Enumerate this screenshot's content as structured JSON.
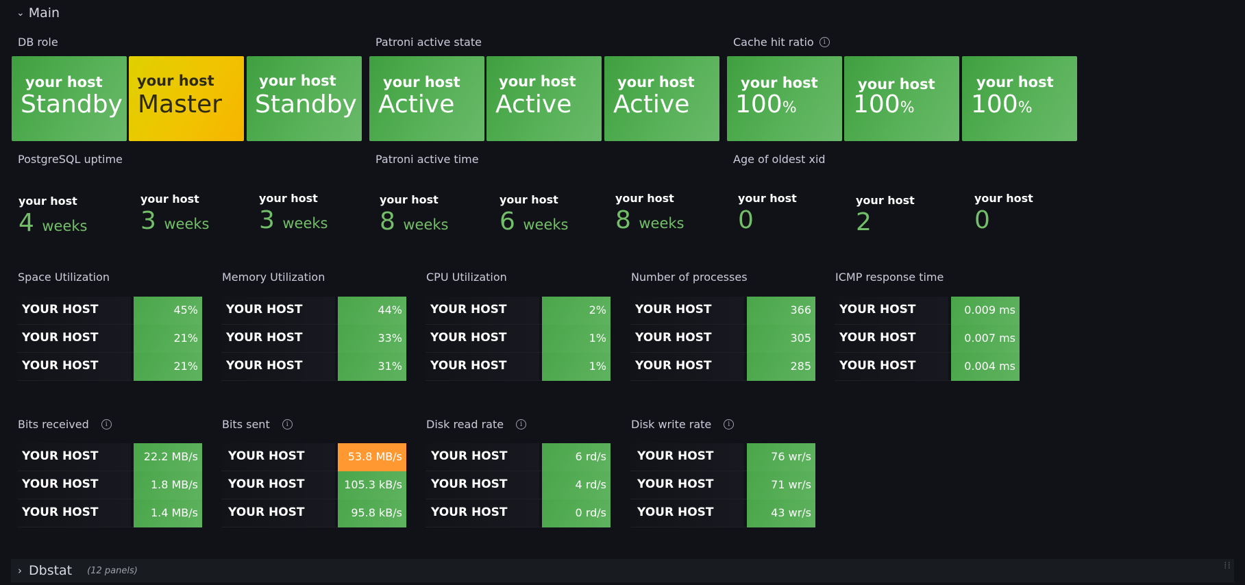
{
  "rows": {
    "main": {
      "label": "Main"
    },
    "dbstat": {
      "label": "Dbstat",
      "count": "(12 panels)"
    }
  },
  "db_role": {
    "title": "DB role",
    "items": [
      {
        "host": "your host",
        "value": "Standby",
        "color": "#56a64b"
      },
      {
        "host": "your host",
        "value": "Master",
        "color": "#f2cc0c"
      },
      {
        "host": "your host",
        "value": "Standby",
        "color": "#56a64b"
      }
    ]
  },
  "patroni_state": {
    "title": "Patroni active state",
    "items": [
      {
        "host": "your host",
        "value": "Active"
      },
      {
        "host": "your host",
        "value": "Active"
      },
      {
        "host": "your host",
        "value": "Active"
      }
    ]
  },
  "cache_hit": {
    "title": "Cache hit ratio",
    "items": [
      {
        "host": "your host",
        "value": "100",
        "unit": "%"
      },
      {
        "host": "your host",
        "value": "100",
        "unit": "%"
      },
      {
        "host": "your host",
        "value": "100",
        "unit": "%"
      }
    ]
  },
  "pg_uptime": {
    "title": "PostgreSQL uptime",
    "items": [
      {
        "host": "your host",
        "value": "4",
        "unit": "weeks"
      },
      {
        "host": "your host",
        "value": "3",
        "unit": "weeks"
      },
      {
        "host": "your host",
        "value": "3",
        "unit": "weeks"
      }
    ]
  },
  "patroni_time": {
    "title": "Patroni active time",
    "items": [
      {
        "host": "your host",
        "value": "8",
        "unit": "weeks"
      },
      {
        "host": "your host",
        "value": "6",
        "unit": "weeks"
      },
      {
        "host": "your host",
        "value": "8",
        "unit": "weeks"
      }
    ]
  },
  "oldest_xid": {
    "title": "Age of oldest xid",
    "items": [
      {
        "host": "your host",
        "value": "0"
      },
      {
        "host": "your host",
        "value": "2"
      },
      {
        "host": "your host",
        "value": "0"
      }
    ]
  },
  "space": {
    "title": "Space Utilization",
    "rows": [
      {
        "host": "YOUR HOST",
        "value": "45%"
      },
      {
        "host": "YOUR HOST",
        "value": "21%"
      },
      {
        "host": "YOUR HOST",
        "value": "21%"
      }
    ]
  },
  "memory": {
    "title": "Memory Utilization",
    "rows": [
      {
        "host": "YOUR HOST",
        "value": "44%"
      },
      {
        "host": "YOUR HOST",
        "value": "33%"
      },
      {
        "host": "YOUR HOST",
        "value": "31%"
      }
    ]
  },
  "cpu": {
    "title": "CPU Utilization",
    "rows": [
      {
        "host": "YOUR HOST",
        "value": "2%"
      },
      {
        "host": "YOUR HOST",
        "value": "1%"
      },
      {
        "host": "YOUR HOST",
        "value": "1%"
      }
    ]
  },
  "procs": {
    "title": "Number of processes",
    "rows": [
      {
        "host": "YOUR HOST",
        "value": "366"
      },
      {
        "host": "YOUR HOST",
        "value": "305"
      },
      {
        "host": "YOUR HOST",
        "value": "285"
      }
    ]
  },
  "icmp": {
    "title": "ICMP response time",
    "rows": [
      {
        "host": "YOUR HOST",
        "value": "0.009 ms"
      },
      {
        "host": "YOUR HOST",
        "value": "0.007 ms"
      },
      {
        "host": "YOUR HOST",
        "value": "0.004 ms"
      }
    ]
  },
  "bits_recv": {
    "title": "Bits received",
    "rows": [
      {
        "host": "YOUR HOST",
        "value": "22.2 MB/s"
      },
      {
        "host": "YOUR HOST",
        "value": "1.8 MB/s"
      },
      {
        "host": "YOUR HOST",
        "value": "1.4 MB/s"
      }
    ]
  },
  "bits_sent": {
    "title": "Bits sent",
    "rows": [
      {
        "host": "YOUR HOST",
        "value": "53.8 MB/s",
        "color": "#ff9830"
      },
      {
        "host": "YOUR HOST",
        "value": "105.3 kB/s"
      },
      {
        "host": "YOUR HOST",
        "value": "95.8 kB/s"
      }
    ]
  },
  "disk_read": {
    "title": "Disk read rate",
    "rows": [
      {
        "host": "YOUR HOST",
        "value": "6 rd/s"
      },
      {
        "host": "YOUR HOST",
        "value": "4 rd/s"
      },
      {
        "host": "YOUR HOST",
        "value": "0 rd/s"
      }
    ]
  },
  "disk_write": {
    "title": "Disk write rate",
    "rows": [
      {
        "host": "YOUR HOST",
        "value": "76 wr/s"
      },
      {
        "host": "YOUR HOST",
        "value": "71 wr/s"
      },
      {
        "host": "YOUR HOST",
        "value": "43 wr/s"
      }
    ]
  },
  "colors": {
    "green": "#73bf69",
    "orange": "#ff9830",
    "yellow": "#f2cc0c",
    "background": "#111217"
  }
}
